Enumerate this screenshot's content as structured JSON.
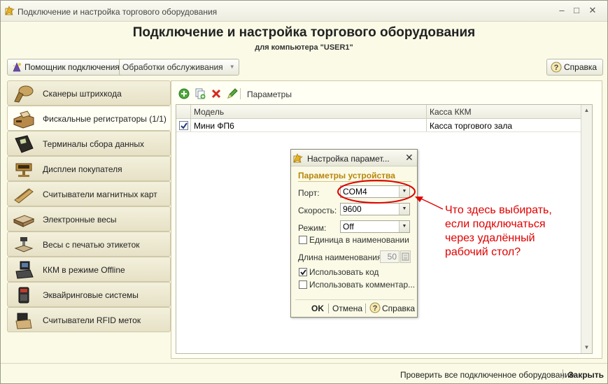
{
  "window": {
    "title": "Подключение и настройка торгового оборудования",
    "controls": {
      "minimize": "–",
      "maximize": "□",
      "close": "✕"
    }
  },
  "header": {
    "title": "Подключение и настройка торгового оборудования",
    "subtitle": "для компьютера \"USER1\""
  },
  "toolbar": {
    "wizard_label": "Помощник подключения",
    "service_label": "Обработки обслуживания",
    "help_label": "Справка"
  },
  "sidebar": {
    "items": [
      {
        "label": "Сканеры штрихкода",
        "icon": "barcode-scanner-icon"
      },
      {
        "label": "Фискальные регистраторы (1/1)",
        "icon": "fiscal-printer-icon"
      },
      {
        "label": "Терминалы сбора данных",
        "icon": "data-terminal-icon"
      },
      {
        "label": "Дисплеи покупателя",
        "icon": "customer-display-icon"
      },
      {
        "label": "Считыватели магнитных карт",
        "icon": "card-reader-icon"
      },
      {
        "label": "Электронные весы",
        "icon": "scales-icon"
      },
      {
        "label": "Весы с печатью этикеток",
        "icon": "label-scales-icon"
      },
      {
        "label": "ККМ в режиме Offline",
        "icon": "offline-register-icon"
      },
      {
        "label": "Эквайринговые системы",
        "icon": "payment-terminal-icon"
      },
      {
        "label": "Считыватели RFID меток",
        "icon": "rfid-reader-icon"
      }
    ],
    "active_index": 1
  },
  "panel": {
    "toolbar_label": "Параметры",
    "columns": [
      "Модель",
      "Касса ККМ"
    ],
    "rows": [
      {
        "checked": true,
        "model": "Мини ФП6",
        "register": "Касса торгового зала"
      }
    ]
  },
  "dialog": {
    "title": "Настройка парамет...",
    "section": "Параметры устройства",
    "port_label": "Порт:",
    "port_value": "COM4",
    "speed_label": "Скорость:",
    "speed_value": "9600",
    "mode_label": "Режим:",
    "mode_value": "Off",
    "unit_in_name_label": "Единица в наименовании",
    "unit_in_name_checked": false,
    "name_length_label": "Длина наименования:",
    "name_length_value": "50",
    "use_code_label": "Использовать код",
    "use_code_checked": true,
    "use_comment_label": "Использовать комментар...",
    "use_comment_checked": false,
    "ok_label": "OK",
    "cancel_label": "Отмена",
    "help_label": "Справка"
  },
  "footer": {
    "check_all_label": "Проверить все подключенное оборудование",
    "close_label": "Закрыть"
  },
  "annotation": {
    "lines": [
      "Что здесь выбирать,",
      "если подключаться",
      "через удалённый",
      "рабочий стол?"
    ],
    "color": "#e00000"
  },
  "colors": {
    "window_bg": "#fafae6",
    "section_heading": "#b8860b",
    "annotation": "#e00000"
  }
}
